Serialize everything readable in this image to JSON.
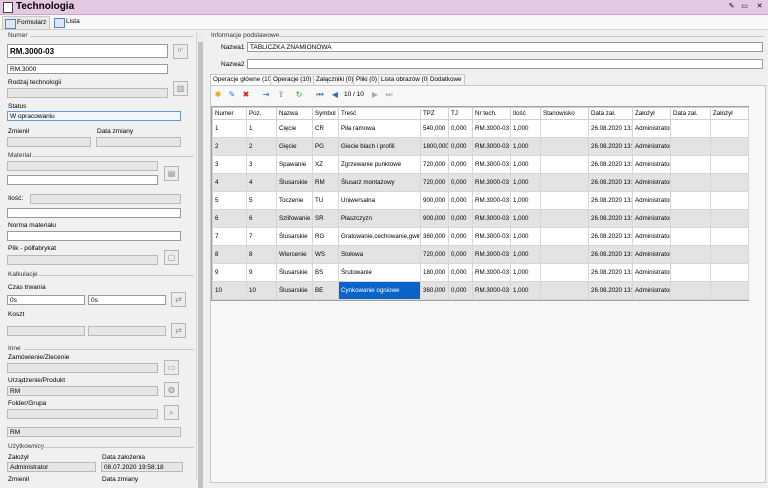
{
  "window": {
    "title": "Technologia"
  },
  "tabs": [
    {
      "label": "Formularz"
    },
    {
      "label": "Lista"
    }
  ],
  "left": {
    "numer": {
      "header": "Numer",
      "value": "RM.3000-03",
      "value2": "RM.3000"
    },
    "rodzaj": {
      "label": "Rodzaj technologii"
    },
    "status": {
      "label": "Status",
      "value": "W opracowaniu"
    },
    "zmienil": {
      "label": "Zmienił"
    },
    "data_zmiany": {
      "label": "Data zmiany"
    },
    "material": {
      "header": "Materiał"
    },
    "ilosc": {
      "label": "Ilość:"
    },
    "norma": {
      "label": "Norma materiału"
    },
    "plik": {
      "label": "Plik - półfabrykat"
    },
    "kalkulacje": {
      "header": "Kalkulacje",
      "czas_label": "Czas trwania",
      "czas1": "0s",
      "czas2": "0s",
      "koszt_label": "Koszt"
    },
    "inne": {
      "header": "Inne",
      "zamowienie_label": "Zamówienie/Zlecenie",
      "urzadzenie_label": "Urządzenie/Produkt",
      "urzadzenie_value": "RM",
      "folder_label": "Folder/Grupa",
      "folder_value2": "RM"
    },
    "uzytkownicy": {
      "header": "Użytkownicy",
      "zalozyl_label": "Założył",
      "zalozyl_value": "Administrator",
      "data_zal_label": "Data założenia",
      "data_zal_value": "08.07.2020 19:58:18",
      "zmienil_label": "Zmienił",
      "data_zm_label": "Data zmiany"
    }
  },
  "info": {
    "header": "Informacje podstawowe",
    "nazwa1_label": "Nazwa1",
    "nazwa1_value": "TABLICZKA ZNAMIONOWA",
    "nazwa2_label": "Nazwa2"
  },
  "subtabs": [
    "Operacje główne (10)",
    "Operacje (10)",
    "Załączniki (0)",
    "Pliki (0)",
    "Lista obrazów (0)",
    "Dodatkowe"
  ],
  "pager": {
    "text": "10 / 10"
  },
  "grid": {
    "columns": [
      "Numer",
      "Poz.",
      "Nazwa",
      "Symbol",
      "Treść",
      "TPZ",
      "TJ",
      "Nr tech.",
      "Ilość",
      "Stanowisko",
      "Data zał.",
      "Założył",
      "Data zał.",
      "Założył"
    ],
    "rows": [
      [
        "1",
        "1",
        "Cięcie",
        "CR",
        "Piła ramowa",
        "540,000",
        "0,000",
        "RM.3000-03",
        "1,000",
        "",
        "26.08.2020 13:30",
        "Administrator",
        "",
        ""
      ],
      [
        "2",
        "2",
        "Gięcie",
        "PG",
        "Giecie blach i profili",
        "1800,000",
        "0,000",
        "RM.3000-03",
        "1,000",
        "",
        "26.08.2020 13:30",
        "Administrator",
        "",
        ""
      ],
      [
        "3",
        "3",
        "Spawanie",
        "XZ",
        "Zgrzewanie punktowe",
        "720,000",
        "0,000",
        "RM.3000-03",
        "1,000",
        "",
        "26.08.2020 13:30",
        "Administrator",
        "",
        ""
      ],
      [
        "4",
        "4",
        "Ślusarskie",
        "RM",
        "Ślusarz montażowy",
        "720,000",
        "0,000",
        "RM.3000-03",
        "1,000",
        "",
        "26.08.2020 13:30",
        "Administrator",
        "",
        ""
      ],
      [
        "5",
        "5",
        "Toczenie",
        "TU",
        "Uniwersalna",
        "900,000",
        "0,000",
        "RM.3000-03",
        "1,000",
        "",
        "26.08.2020 13:30",
        "Administrator",
        "",
        ""
      ],
      [
        "6",
        "6",
        "Szlifowanie",
        "SR",
        "Płaszczyzn",
        "900,000",
        "0,000",
        "RM.3000-03",
        "1,000",
        "",
        "26.08.2020 13:30",
        "Administrator",
        "",
        ""
      ],
      [
        "7",
        "7",
        "Ślusarskie",
        "RG",
        "Gratowanie,cechowanie,gwint",
        "360,000",
        "0,000",
        "RM.3000-03",
        "1,000",
        "",
        "26.08.2020 13:31",
        "Administrator",
        "",
        ""
      ],
      [
        "8",
        "8",
        "Wiercenie",
        "WS",
        "Stołowa",
        "720,000",
        "0,000",
        "RM.3000-03",
        "1,000",
        "",
        "26.08.2020 13:31",
        "Administrator",
        "",
        ""
      ],
      [
        "9",
        "9",
        "Ślusarskie",
        "BS",
        "Śrutowanie",
        "180,000",
        "0,000",
        "RM.3000-03",
        "1,000",
        "",
        "26.08.2020 13:31",
        "Administrator",
        "",
        ""
      ],
      [
        "10",
        "10",
        "Ślusarskie",
        "BE",
        "Cynkowanie ogniowe",
        "360,000",
        "0,000",
        "RM.3000-03",
        "1,000",
        "",
        "26.08.2020 13:31",
        "Administrator",
        "",
        ""
      ]
    ]
  },
  "icons": {
    "app": "document-icon",
    "grid": "grid-icon",
    "list": "list-icon"
  }
}
